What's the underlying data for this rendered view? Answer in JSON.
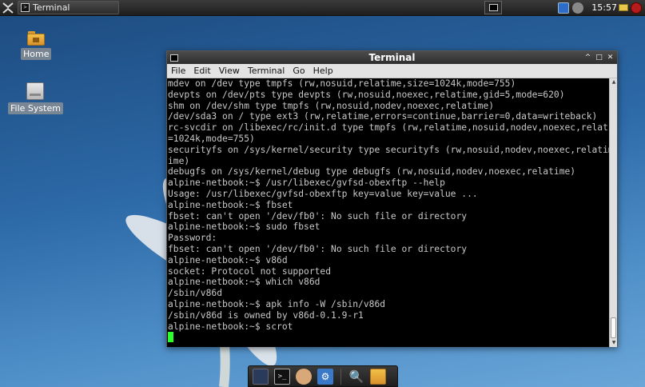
{
  "top_panel": {
    "task_label": "Terminal",
    "clock": "15:57"
  },
  "desktop": {
    "icons": [
      {
        "label": "Home"
      },
      {
        "label": "File System"
      }
    ]
  },
  "window": {
    "title": "Terminal",
    "buttons": {
      "minimize": "^",
      "maximize": "□",
      "close": "✕"
    },
    "menu": [
      "File",
      "Edit",
      "View",
      "Terminal",
      "Go",
      "Help"
    ],
    "lines": [
      "mdev on /dev type tmpfs (rw,nosuid,relatime,size=1024k,mode=755)",
      "devpts on /dev/pts type devpts (rw,nosuid,noexec,relatime,gid=5,mode=620)",
      "shm on /dev/shm type tmpfs (rw,nosuid,nodev,noexec,relatime)",
      "/dev/sda3 on / type ext3 (rw,relatime,errors=continue,barrier=0,data=writeback)",
      "rc-svcdir on /libexec/rc/init.d type tmpfs (rw,relatime,nosuid,nodev,noexec,relatime,size",
      "=1024k,mode=755)",
      "securityfs on /sys/kernel/security type securityfs (rw,nosuid,nodev,noexec,relatime)",
      "ime)",
      "debugfs on /sys/kernel/debug type debugfs (rw,nosuid,nodev,noexec,relatime)",
      "alpine-netbook:~$ /usr/libexec/gvfsd-obexftp --help",
      "Usage: /usr/libexec/gvfsd-obexftp key=value key=value ...",
      "alpine-netbook:~$ fbset",
      "fbset: can't open '/dev/fb0': No such file or directory",
      "alpine-netbook:~$ sudo fbset",
      "Password:",
      "fbset: can't open '/dev/fb0': No such file or directory",
      "alpine-netbook:~$ v86d",
      "socket: Protocol not supported",
      "alpine-netbook:~$ which v86d",
      "/sbin/v86d",
      "alpine-netbook:~$ apk info -W /sbin/v86d",
      "/sbin/v86d is owned by v86d-0.1.9-r1",
      "alpine-netbook:~$ scrot"
    ],
    "scroll": {
      "up": "▲",
      "down": "▼"
    }
  },
  "colors": {
    "cursor": "#2bff2b",
    "terminal_bg": "#000000",
    "terminal_fg": "#c8c8c8"
  },
  "dock": {
    "items": [
      "desktop-icon",
      "terminal-icon",
      "web-browser-icon",
      "settings-icon",
      "search-icon",
      "folder-icon"
    ]
  }
}
